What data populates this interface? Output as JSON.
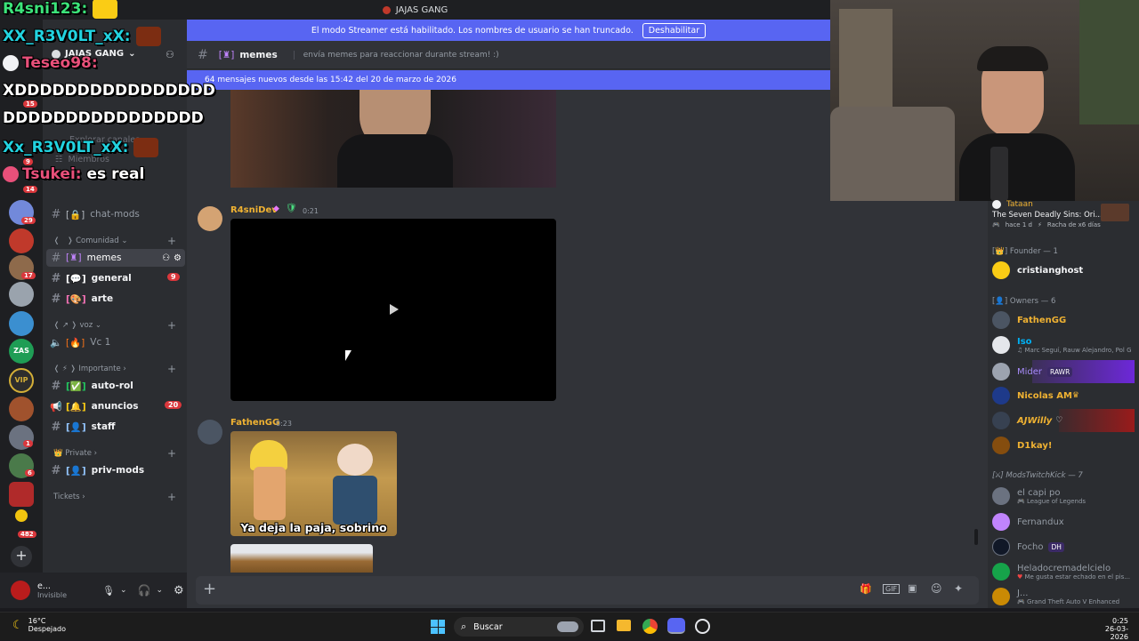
{
  "window": {
    "title": "JAJAS GANG",
    "clock_time": "0:25",
    "clock_date": "26-03-2026"
  },
  "streamer_banner": {
    "text": "El modo Streamer está habilitado. Los nombres de usuario se han truncado.",
    "button": "Deshabilitar"
  },
  "server": {
    "name": "JAJAS GANG"
  },
  "channel_header": {
    "name": "memes",
    "topic": "envía memes para reaccionar durante stream! :)"
  },
  "new_messages_bar": "64 mensajes nuevos desde las 15:42 del 20 de marzo de 2026",
  "sidebar": {
    "partial_items": [
      "Explorar canales",
      "Miembros"
    ],
    "channels_top": [
      {
        "name": "chat-mods",
        "icon": "lock-icon"
      }
    ],
    "category_comunidad": "Comunidad",
    "comunidad": [
      {
        "name": "memes",
        "icon": "castle-icon"
      },
      {
        "name": "general",
        "icon": "speech-icon",
        "badge": "9"
      },
      {
        "name": "arte",
        "icon": "palette-icon"
      }
    ],
    "category_voz": "voz",
    "voz": [
      {
        "name": "Vc 1",
        "icon": "fire-icon"
      }
    ],
    "category_importante": "Importante",
    "importante": [
      {
        "name": "auto-rol",
        "icon": "check-icon"
      },
      {
        "name": "anuncios",
        "icon": "bell-icon",
        "badge": "20"
      },
      {
        "name": "staff",
        "icon": "person-icon"
      }
    ],
    "category_private": "Private",
    "private": [
      {
        "name": "priv-mods",
        "icon": "person-icon"
      }
    ],
    "category_tickets": "Tickets"
  },
  "server_badges": [
    "15",
    "9",
    "14",
    "7",
    "29",
    "17",
    "1",
    "6",
    "482"
  ],
  "user_panel": {
    "name": "e...",
    "status": "Invisible"
  },
  "messages": [
    {
      "author": "R4sniDev",
      "time": "0:21"
    },
    {
      "author": "FathenGG",
      "time": "0:23",
      "caption": "Ya deja la paja, sobrino"
    }
  ],
  "members": {
    "activity": {
      "name": "Tataan",
      "game": "The Seven Deadly Sins: Ori...",
      "meta": "hace 1 d",
      "streak": "Racha de x6 días"
    },
    "groups": [
      {
        "label": "Founder — 1",
        "members": [
          {
            "name": "cristianghost",
            "color": "#f2f3f5"
          }
        ]
      },
      {
        "label": "Owners — 6",
        "members": [
          {
            "name": "FathenGG",
            "color": "#f0b232"
          },
          {
            "name": "Iso",
            "color": "#00b0f4",
            "sub": "Marc Seguí, Rauw Alejandro, Pol G"
          },
          {
            "name": "Mider",
            "color": "#a78bfa",
            "tag": "RAWR"
          },
          {
            "name": "Nicolas AM",
            "color": "#f0b232"
          },
          {
            "name": "AJWilly",
            "color": "#f0b232"
          },
          {
            "name": "D1kay!",
            "color": "#f0b232"
          }
        ]
      },
      {
        "label": "ModsTwitchKick — 7",
        "members": [
          {
            "name": "el capi po",
            "color": "#949ba4",
            "sub": "League of Legends"
          },
          {
            "name": "Fernandux",
            "color": "#949ba4"
          },
          {
            "name": "Focho",
            "color": "#949ba4",
            "tag": "DH"
          },
          {
            "name": "Heladocremadelcielo",
            "color": "#949ba4",
            "sub": "Me gusta estar echado en el pis..."
          },
          {
            "name": "J...",
            "color": "#949ba4",
            "sub": "Grand Theft Auto V Enhanced"
          }
        ]
      }
    ]
  },
  "chat_overlay": [
    {
      "user": "R4sni123:",
      "color": "#3ce37a",
      "text": ""
    },
    {
      "user": "XX_R3V0LT_xX:",
      "color": "#22d3e0",
      "text": ""
    },
    {
      "user": "Teseo98:",
      "color": "#e8507a",
      "text": ""
    },
    {
      "user": "",
      "color": "#ffffff",
      "text": "XDDDDDDDDDDDDDDDD"
    },
    {
      "user": "",
      "color": "#ffffff",
      "text": "DDDDDDDDDDDDDDDD"
    },
    {
      "user": "Xx_R3V0LT_xX:",
      "color": "#22d3e0",
      "text": ""
    },
    {
      "user": "Tsukei:",
      "color": "#e8507a",
      "text": "es real"
    }
  ],
  "taskbar": {
    "weather_temp": "16°C",
    "weather_desc": "Despejado",
    "search": "Buscar"
  }
}
